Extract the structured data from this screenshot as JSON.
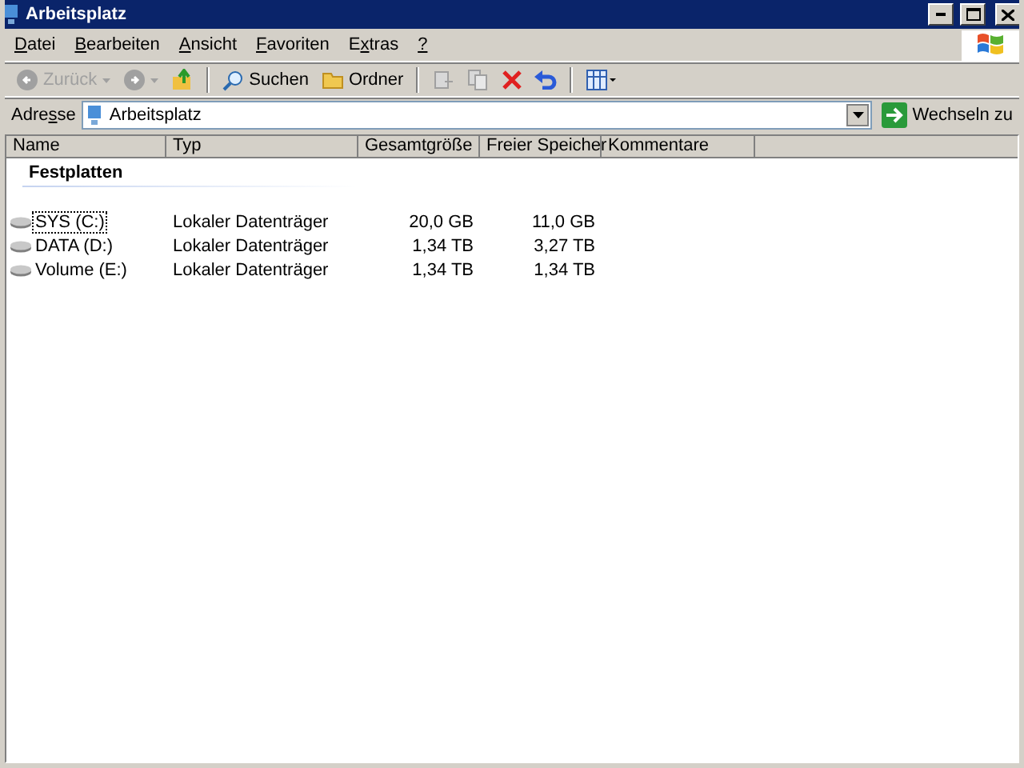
{
  "window": {
    "title": "Arbeitsplatz"
  },
  "menu": [
    {
      "label": "Datei"
    },
    {
      "label": "Bearbeiten"
    },
    {
      "label": "Ansicht"
    },
    {
      "label": "Favoriten"
    },
    {
      "label": "Extras"
    },
    {
      "label": "?"
    }
  ],
  "toolbar": [
    {
      "kind": "back",
      "label": "Zurück",
      "disabled": true
    },
    {
      "kind": "forward",
      "disabled": true
    },
    {
      "kind": "up",
      "disabled": false
    },
    {
      "kind": "sep"
    },
    {
      "kind": "search",
      "label": "Suchen",
      "disabled": false
    },
    {
      "kind": "folders",
      "label": "Ordner",
      "disabled": false
    },
    {
      "kind": "sep"
    },
    {
      "kind": "move",
      "disabled": true
    },
    {
      "kind": "copy",
      "disabled": true
    },
    {
      "kind": "delete",
      "disabled": false
    },
    {
      "kind": "undo",
      "disabled": false
    },
    {
      "kind": "sep"
    },
    {
      "kind": "views",
      "disabled": false
    }
  ],
  "address": {
    "label": "Adresse",
    "value": "Arbeitsplatz",
    "go": "Wechseln zu"
  },
  "table": {
    "columns": [
      {
        "label": "Name"
      },
      {
        "label": "Typ"
      },
      {
        "label": "Gesamtgröße"
      },
      {
        "label": "Freier Speicher"
      },
      {
        "label": "Kommentare"
      }
    ],
    "group": "Festplatten",
    "rows": [
      {
        "name": "SYS (C:)",
        "type": "Lokaler Datenträger",
        "total": "20,0 GB",
        "free": "11,0 GB",
        "focused": true
      },
      {
        "name": "DATA (D:)",
        "type": "Lokaler Datenträger",
        "total": "1,34 TB",
        "free": "3,27 TB",
        "focused": false
      },
      {
        "name": "Volume (E:)",
        "type": "Lokaler Datenträger",
        "total": "1,34 TB",
        "free": "1,34 TB",
        "focused": false
      }
    ]
  }
}
